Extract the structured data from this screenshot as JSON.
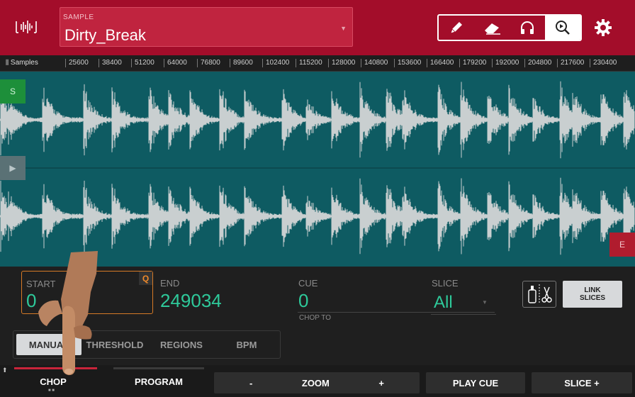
{
  "header": {
    "sample_label": "SAMPLE",
    "sample_name": "Dirty_Break",
    "tools": [
      {
        "name": "pencil-icon",
        "active": false
      },
      {
        "name": "eraser-icon",
        "active": false
      },
      {
        "name": "headphones-icon",
        "active": false
      },
      {
        "name": "zoom-icon",
        "active": true
      }
    ],
    "settings_icon": "gear-icon"
  },
  "ruler": {
    "label": "Samples",
    "ticks": [
      "25600",
      "38400",
      "51200",
      "64000",
      "76800",
      "89600",
      "102400",
      "115200",
      "128000",
      "140800",
      "153600",
      "166400",
      "179200",
      "192000",
      "204800",
      "217600",
      "230400"
    ]
  },
  "markers": {
    "start": "S",
    "end": "E"
  },
  "params": {
    "start_label": "START",
    "start_value": "0",
    "q_badge": "Q",
    "end_label": "END",
    "end_value": "249034",
    "cue_label": "CUE",
    "cue_value": "0",
    "chop_to_label": "CHOP TO",
    "slice_label": "SLICE",
    "slice_value": "All",
    "link_slices_line1": "LINK",
    "link_slices_line2": "SLICES"
  },
  "modes": {
    "items": [
      "MANUAL",
      "THRESHOLD",
      "REGIONS",
      "BPM"
    ],
    "active": "MANUAL"
  },
  "footer": {
    "tab_chop": "CHOP",
    "tab_program": "PROGRAM",
    "zoom_minus": "-",
    "zoom_label": "ZOOM",
    "zoom_plus": "+",
    "play_cue": "PLAY CUE",
    "slice_plus": "SLICE +"
  },
  "colors": {
    "header": "#a30d2a",
    "waveform_bg": "#0e5b62",
    "accent_green": "#2ec99a",
    "start_marker": "#1d8f3a",
    "end_marker": "#b01c2e"
  }
}
